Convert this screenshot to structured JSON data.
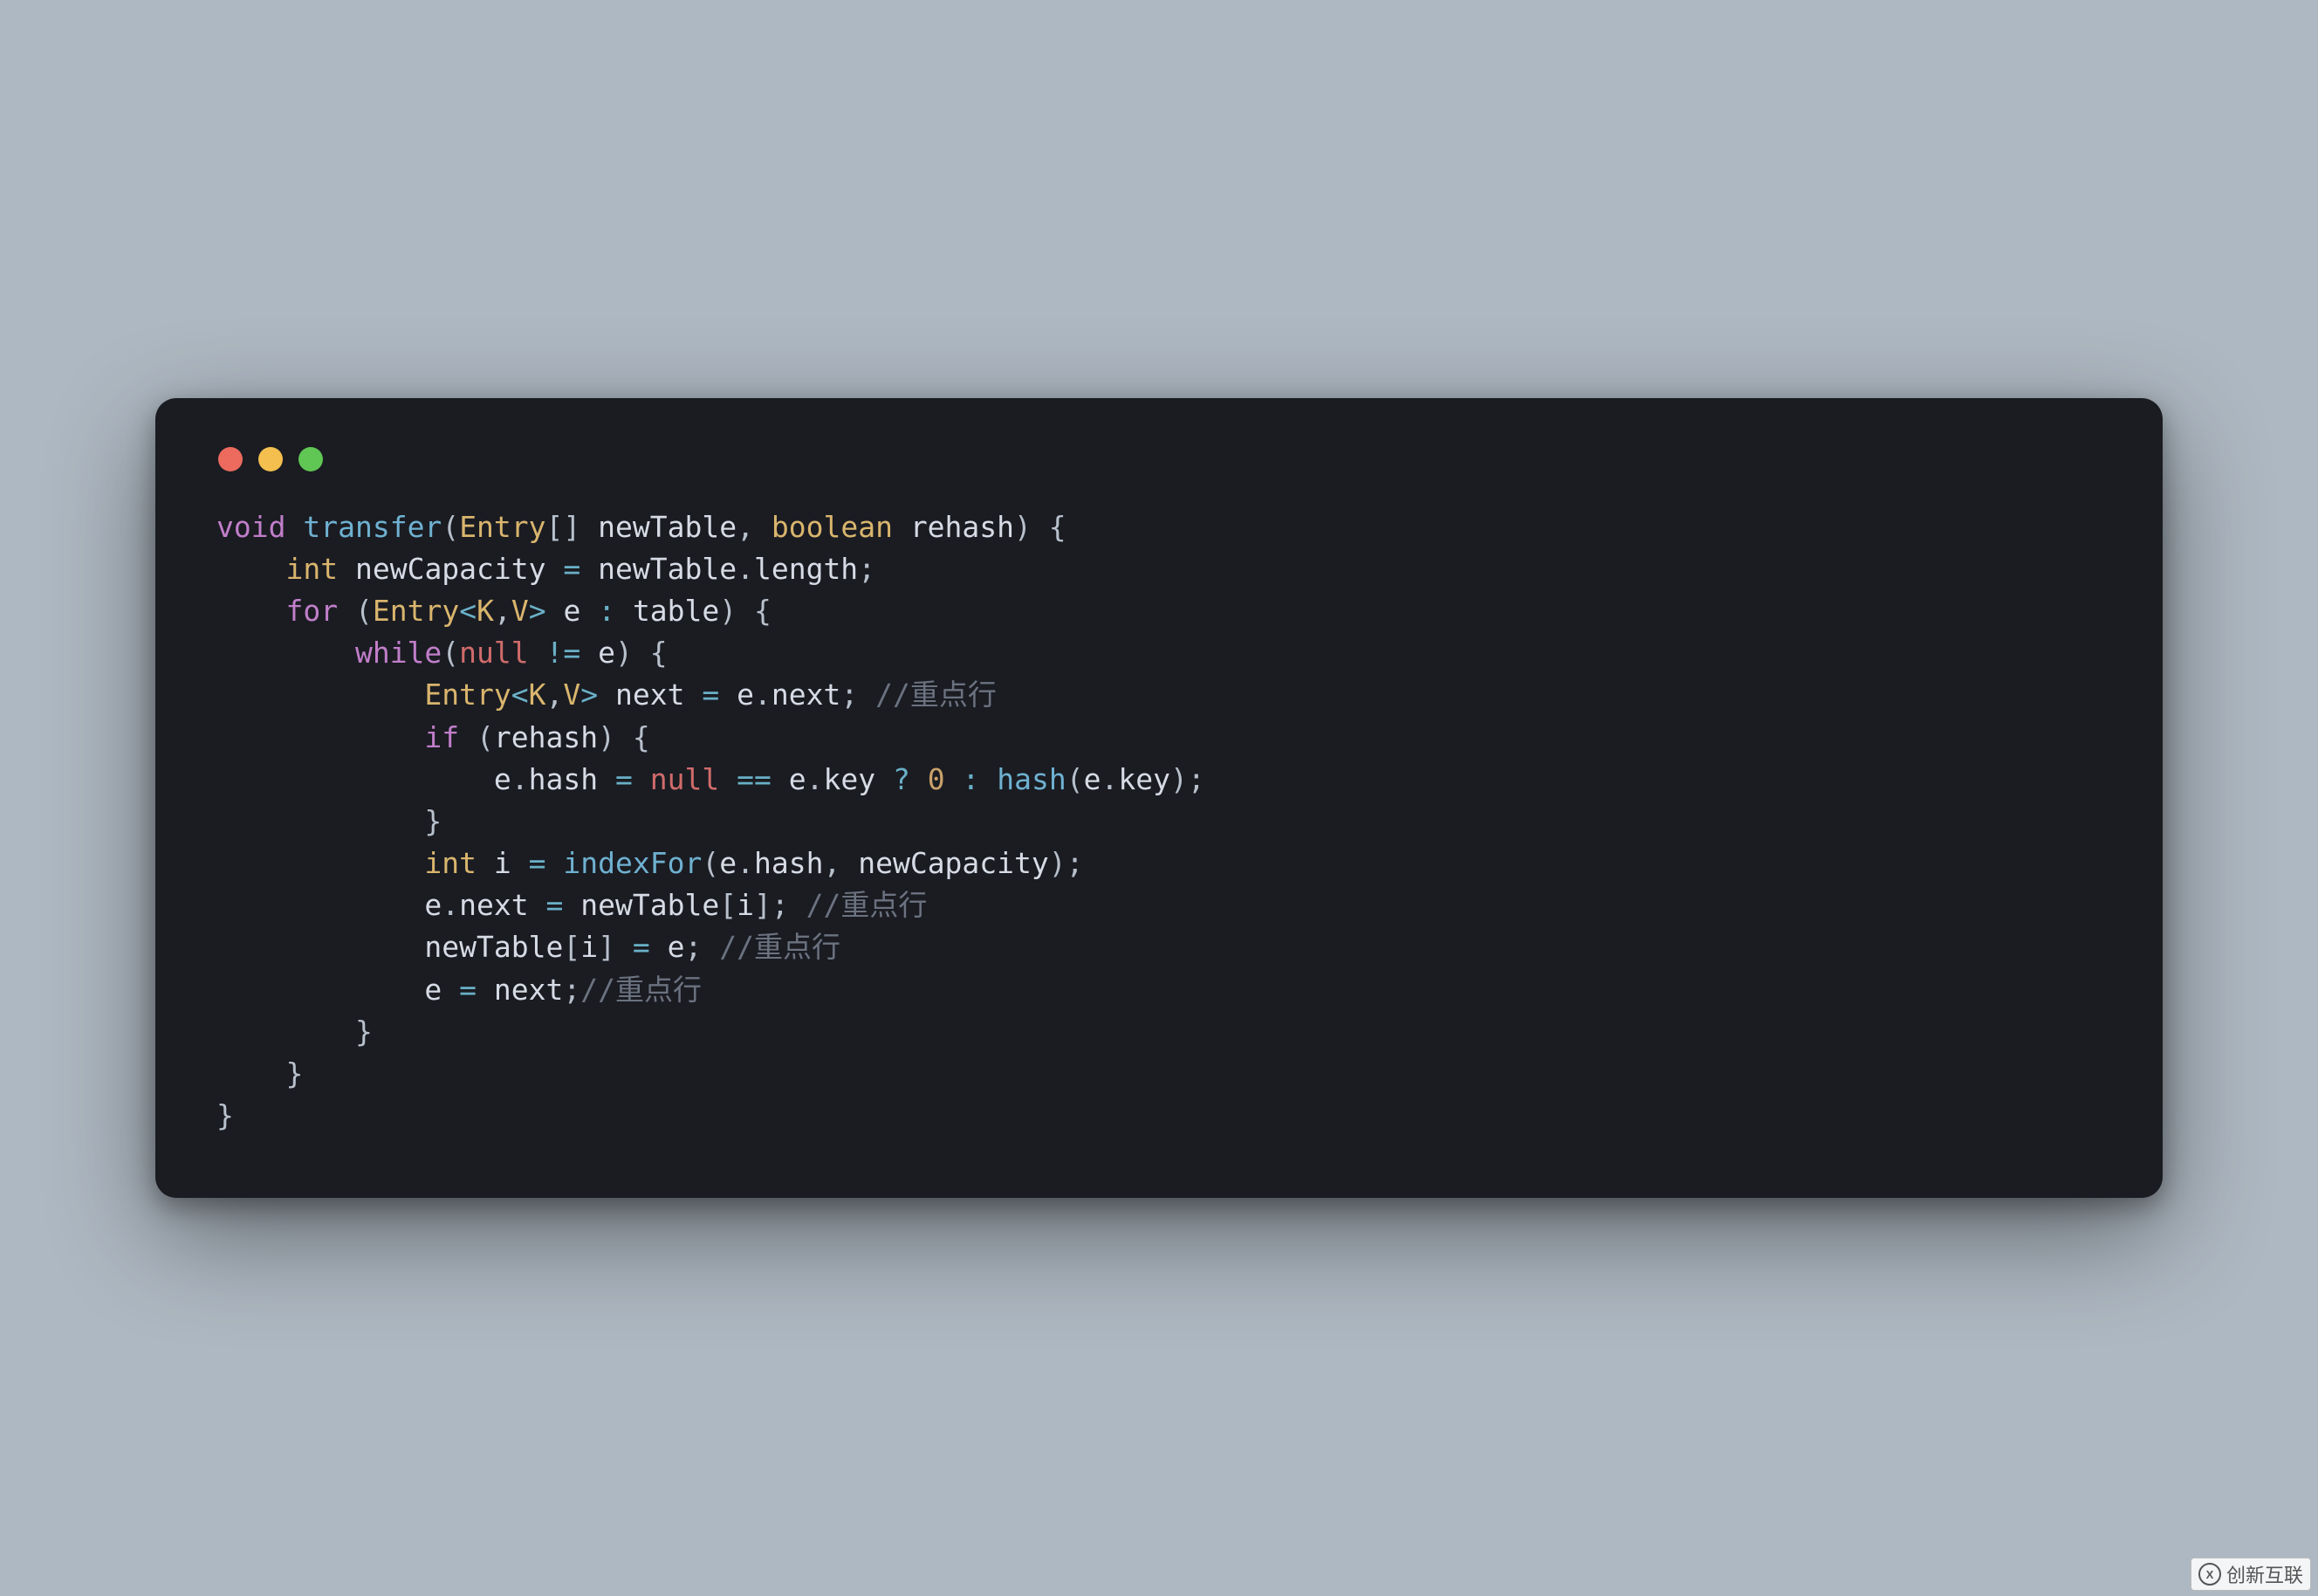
{
  "window": {
    "traffic_lights": [
      "close",
      "minimize",
      "zoom"
    ]
  },
  "code": {
    "language": "java",
    "tokens": [
      [
        [
          "kw",
          "void"
        ],
        [
          "sp",
          " "
        ],
        [
          "fn",
          "transfer"
        ],
        [
          "punc",
          "("
        ],
        [
          "type",
          "Entry"
        ],
        [
          "punc",
          "["
        ],
        [
          "punc",
          "]"
        ],
        [
          "sp",
          " "
        ],
        [
          "var",
          "newTable"
        ],
        [
          "punc",
          ","
        ],
        [
          "sp",
          " "
        ],
        [
          "type",
          "boolean"
        ],
        [
          "sp",
          " "
        ],
        [
          "var",
          "rehash"
        ],
        [
          "punc",
          ")"
        ],
        [
          "sp",
          " "
        ],
        [
          "punc",
          "{"
        ]
      ],
      [
        [
          "indent",
          "    "
        ],
        [
          "type",
          "int"
        ],
        [
          "sp",
          " "
        ],
        [
          "var",
          "newCapacity"
        ],
        [
          "sp",
          " "
        ],
        [
          "op",
          "="
        ],
        [
          "sp",
          " "
        ],
        [
          "var",
          "newTable"
        ],
        [
          "punc",
          "."
        ],
        [
          "prop",
          "length"
        ],
        [
          "punc",
          ";"
        ]
      ],
      [
        [
          "indent",
          "    "
        ],
        [
          "kw",
          "for"
        ],
        [
          "sp",
          " "
        ],
        [
          "punc",
          "("
        ],
        [
          "type",
          "Entry"
        ],
        [
          "op",
          "<"
        ],
        [
          "type",
          "K"
        ],
        [
          "punc",
          ","
        ],
        [
          "type",
          "V"
        ],
        [
          "op",
          ">"
        ],
        [
          "sp",
          " "
        ],
        [
          "var",
          "e"
        ],
        [
          "sp",
          " "
        ],
        [
          "op",
          ":"
        ],
        [
          "sp",
          " "
        ],
        [
          "var",
          "table"
        ],
        [
          "punc",
          ")"
        ],
        [
          "sp",
          " "
        ],
        [
          "punc",
          "{"
        ]
      ],
      [
        [
          "indent",
          "        "
        ],
        [
          "kw",
          "while"
        ],
        [
          "punc",
          "("
        ],
        [
          "null",
          "null"
        ],
        [
          "sp",
          " "
        ],
        [
          "op",
          "!="
        ],
        [
          "sp",
          " "
        ],
        [
          "var",
          "e"
        ],
        [
          "punc",
          ")"
        ],
        [
          "sp",
          " "
        ],
        [
          "punc",
          "{"
        ]
      ],
      [
        [
          "indent",
          "            "
        ],
        [
          "type",
          "Entry"
        ],
        [
          "op",
          "<"
        ],
        [
          "type",
          "K"
        ],
        [
          "punc",
          ","
        ],
        [
          "type",
          "V"
        ],
        [
          "op",
          ">"
        ],
        [
          "sp",
          " "
        ],
        [
          "var",
          "next"
        ],
        [
          "sp",
          " "
        ],
        [
          "op",
          "="
        ],
        [
          "sp",
          " "
        ],
        [
          "var",
          "e"
        ],
        [
          "punc",
          "."
        ],
        [
          "prop",
          "next"
        ],
        [
          "punc",
          ";"
        ],
        [
          "sp",
          " "
        ],
        [
          "comment",
          "//重点行"
        ]
      ],
      [
        [
          "indent",
          "            "
        ],
        [
          "kw",
          "if"
        ],
        [
          "sp",
          " "
        ],
        [
          "punc",
          "("
        ],
        [
          "var",
          "rehash"
        ],
        [
          "punc",
          ")"
        ],
        [
          "sp",
          " "
        ],
        [
          "punc",
          "{"
        ]
      ],
      [
        [
          "indent",
          "                "
        ],
        [
          "var",
          "e"
        ],
        [
          "punc",
          "."
        ],
        [
          "prop",
          "hash"
        ],
        [
          "sp",
          " "
        ],
        [
          "op",
          "="
        ],
        [
          "sp",
          " "
        ],
        [
          "null",
          "null"
        ],
        [
          "sp",
          " "
        ],
        [
          "op",
          "=="
        ],
        [
          "sp",
          " "
        ],
        [
          "var",
          "e"
        ],
        [
          "punc",
          "."
        ],
        [
          "prop",
          "key"
        ],
        [
          "sp",
          " "
        ],
        [
          "op",
          "?"
        ],
        [
          "sp",
          " "
        ],
        [
          "num",
          "0"
        ],
        [
          "sp",
          " "
        ],
        [
          "op",
          ":"
        ],
        [
          "sp",
          " "
        ],
        [
          "fn",
          "hash"
        ],
        [
          "punc",
          "("
        ],
        [
          "var",
          "e"
        ],
        [
          "punc",
          "."
        ],
        [
          "prop",
          "key"
        ],
        [
          "punc",
          ")"
        ],
        [
          "punc",
          ";"
        ]
      ],
      [
        [
          "indent",
          "            "
        ],
        [
          "punc",
          "}"
        ]
      ],
      [
        [
          "indent",
          "            "
        ],
        [
          "type",
          "int"
        ],
        [
          "sp",
          " "
        ],
        [
          "var",
          "i"
        ],
        [
          "sp",
          " "
        ],
        [
          "op",
          "="
        ],
        [
          "sp",
          " "
        ],
        [
          "fn",
          "indexFor"
        ],
        [
          "punc",
          "("
        ],
        [
          "var",
          "e"
        ],
        [
          "punc",
          "."
        ],
        [
          "prop",
          "hash"
        ],
        [
          "punc",
          ","
        ],
        [
          "sp",
          " "
        ],
        [
          "var",
          "newCapacity"
        ],
        [
          "punc",
          ")"
        ],
        [
          "punc",
          ";"
        ]
      ],
      [
        [
          "indent",
          "            "
        ],
        [
          "var",
          "e"
        ],
        [
          "punc",
          "."
        ],
        [
          "prop",
          "next"
        ],
        [
          "sp",
          " "
        ],
        [
          "op",
          "="
        ],
        [
          "sp",
          " "
        ],
        [
          "var",
          "newTable"
        ],
        [
          "punc",
          "["
        ],
        [
          "var",
          "i"
        ],
        [
          "punc",
          "]"
        ],
        [
          "punc",
          ";"
        ],
        [
          "sp",
          " "
        ],
        [
          "comment",
          "//重点行"
        ]
      ],
      [
        [
          "indent",
          "            "
        ],
        [
          "var",
          "newTable"
        ],
        [
          "punc",
          "["
        ],
        [
          "var",
          "i"
        ],
        [
          "punc",
          "]"
        ],
        [
          "sp",
          " "
        ],
        [
          "op",
          "="
        ],
        [
          "sp",
          " "
        ],
        [
          "var",
          "e"
        ],
        [
          "punc",
          ";"
        ],
        [
          "sp",
          " "
        ],
        [
          "comment",
          "//重点行"
        ]
      ],
      [
        [
          "indent",
          "            "
        ],
        [
          "var",
          "e"
        ],
        [
          "sp",
          " "
        ],
        [
          "op",
          "="
        ],
        [
          "sp",
          " "
        ],
        [
          "var",
          "next"
        ],
        [
          "punc",
          ";"
        ],
        [
          "comment",
          "//重点行"
        ]
      ],
      [
        [
          "indent",
          "        "
        ],
        [
          "punc",
          "}"
        ]
      ],
      [
        [
          "indent",
          "    "
        ],
        [
          "punc",
          "}"
        ]
      ],
      [
        [
          "punc",
          "}"
        ]
      ]
    ]
  },
  "watermark": {
    "text": "创新互联",
    "icon_letter": "X"
  }
}
